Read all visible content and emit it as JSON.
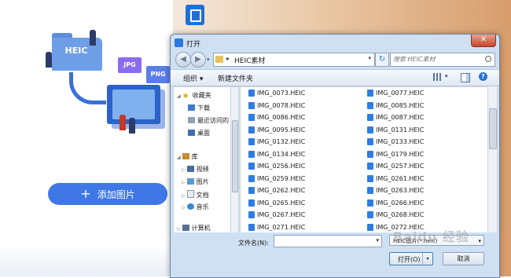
{
  "app": {
    "add_button_label": "添加图片",
    "heic_label": "HEIC",
    "jpg_label": "JPG",
    "png_label": "PNG"
  },
  "dialog": {
    "title": "打开",
    "address_path": "HEIC素材",
    "search_placeholder": "搜索 HEIC素材",
    "toolbar": {
      "organize": "组织 ▾",
      "new_folder": "新建文件夹"
    },
    "nav": {
      "favorites": "收藏夹",
      "downloads": "下载",
      "recent": "最近访问的",
      "desktop": "桌面",
      "libraries": "库",
      "videos": "视频",
      "pictures": "图片",
      "documents": "文档",
      "music": "音乐",
      "computer": "计算机"
    },
    "files_col1": [
      "IMG_0073.HEIC",
      "IMG_0078.HEIC",
      "IMG_0086.HEIC",
      "IMG_0095.HEIC",
      "IMG_0132.HEIC",
      "IMG_0134.HEIC",
      "IMG_0256.HEIC",
      "IMG_0259.HEIC",
      "IMG_0262.HEIC",
      "IMG_0265.HEIC",
      "IMG_0267.HEIC",
      "IMG_0271.HEIC"
    ],
    "files_col2": [
      "IMG_0077.HEIC",
      "IMG_0085.HEIC",
      "IMG_0087.HEIC",
      "IMG_0131.HEIC",
      "IMG_0133.HEIC",
      "IMG_0179.HEIC",
      "IMG_0257.HEIC",
      "IMG_0261.HEIC",
      "IMG_0263.HEIC",
      "IMG_0266.HEIC",
      "IMG_0268.HEIC",
      "IMG_0272.HEIC"
    ],
    "filename_label": "文件名(N):",
    "filename_value": "",
    "file_type": "HEIC图片(*.heic)",
    "open_label": "打开(O)",
    "cancel_label": "取消"
  },
  "watermark": "Baidu 经验"
}
